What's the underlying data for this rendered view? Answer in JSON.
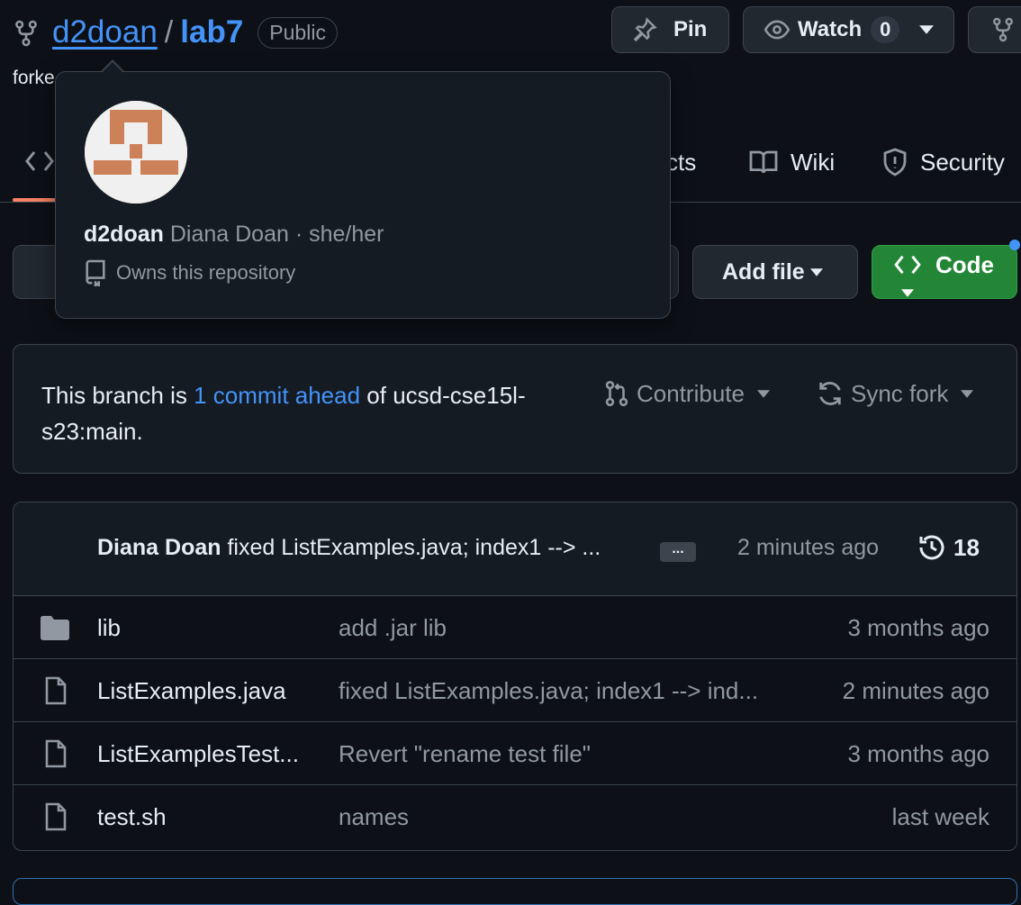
{
  "header": {
    "owner": "d2doan",
    "separator": "/",
    "repo": "lab7",
    "visibility": "Public",
    "pin_label": "Pin",
    "watch_label": "Watch",
    "watch_count": "0",
    "forked_from": "forke"
  },
  "tabs": [
    {
      "label": "cts"
    },
    {
      "label": "Wiki"
    },
    {
      "label": "Security"
    }
  ],
  "popover": {
    "username": "d2doan",
    "fullname": "Diana Doan",
    "pronouns": "· she/her",
    "relation": "Owns this repository"
  },
  "actions": {
    "add_file_label": "Add file",
    "code_label": "Code"
  },
  "banner": {
    "prefix": "This branch is",
    "link": "1 commit ahead",
    "suffix_line1": "of ucsd-cse15l-",
    "suffix_line2": "s23:main.",
    "contribute_label": "Contribute",
    "sync_label": "Sync fork"
  },
  "latest_commit": {
    "author": "Diana Doan",
    "message": "fixed ListExamples.java; index1 --> ...",
    "ellipsis": "...",
    "time": "2 minutes ago",
    "commit_count": "18"
  },
  "files": [
    {
      "type": "folder",
      "name": "lib",
      "message": "add .jar lib",
      "time": "3 months ago"
    },
    {
      "type": "file",
      "name": "ListExamples.java",
      "message": "fixed ListExamples.java; index1 --> ind...",
      "time": "2 minutes ago"
    },
    {
      "type": "file",
      "name": "ListExamplesTest...",
      "message": "Revert \"rename test file\"",
      "time": "3 months ago"
    },
    {
      "type": "file",
      "name": "test.sh",
      "message": "names",
      "time": "last week"
    }
  ],
  "colors": {
    "background": "#0d1117",
    "link": "#4493f8",
    "code_button": "#238636",
    "avatar_pattern": "#cd8159"
  }
}
